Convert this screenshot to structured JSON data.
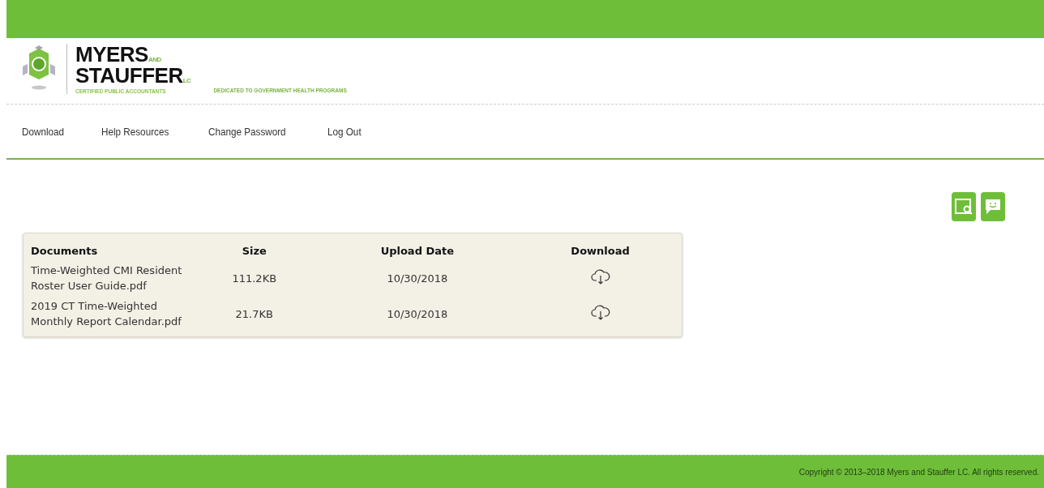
{
  "logo": {
    "line1": "MYERS",
    "and": "AND",
    "line2": "STAUFFER",
    "suffix": "LC",
    "subtitle": "CERTIFIED PUBLIC ACCOUNTANTS"
  },
  "tagline": "DEDICATED TO GOVERNMENT HEALTH PROGRAMS",
  "nav": [
    "Download",
    "Help Resources",
    "Change Password",
    "Log Out"
  ],
  "table": {
    "columns": [
      "Documents",
      "Size",
      "Upload Date",
      "Download"
    ],
    "rows": [
      {
        "document": "Time-Weighted CMI Resident Roster User Guide.pdf",
        "size": "111.2KB",
        "upload_date": "10/30/2018"
      },
      {
        "document": "2019 CT Time-Weighted Monthly Report Calendar.pdf",
        "size": "21.7KB",
        "upload_date": "10/30/2018"
      }
    ]
  },
  "footer": "Copyright © 2013–2018 Myers and Stauffer LC. All rights reserved."
}
